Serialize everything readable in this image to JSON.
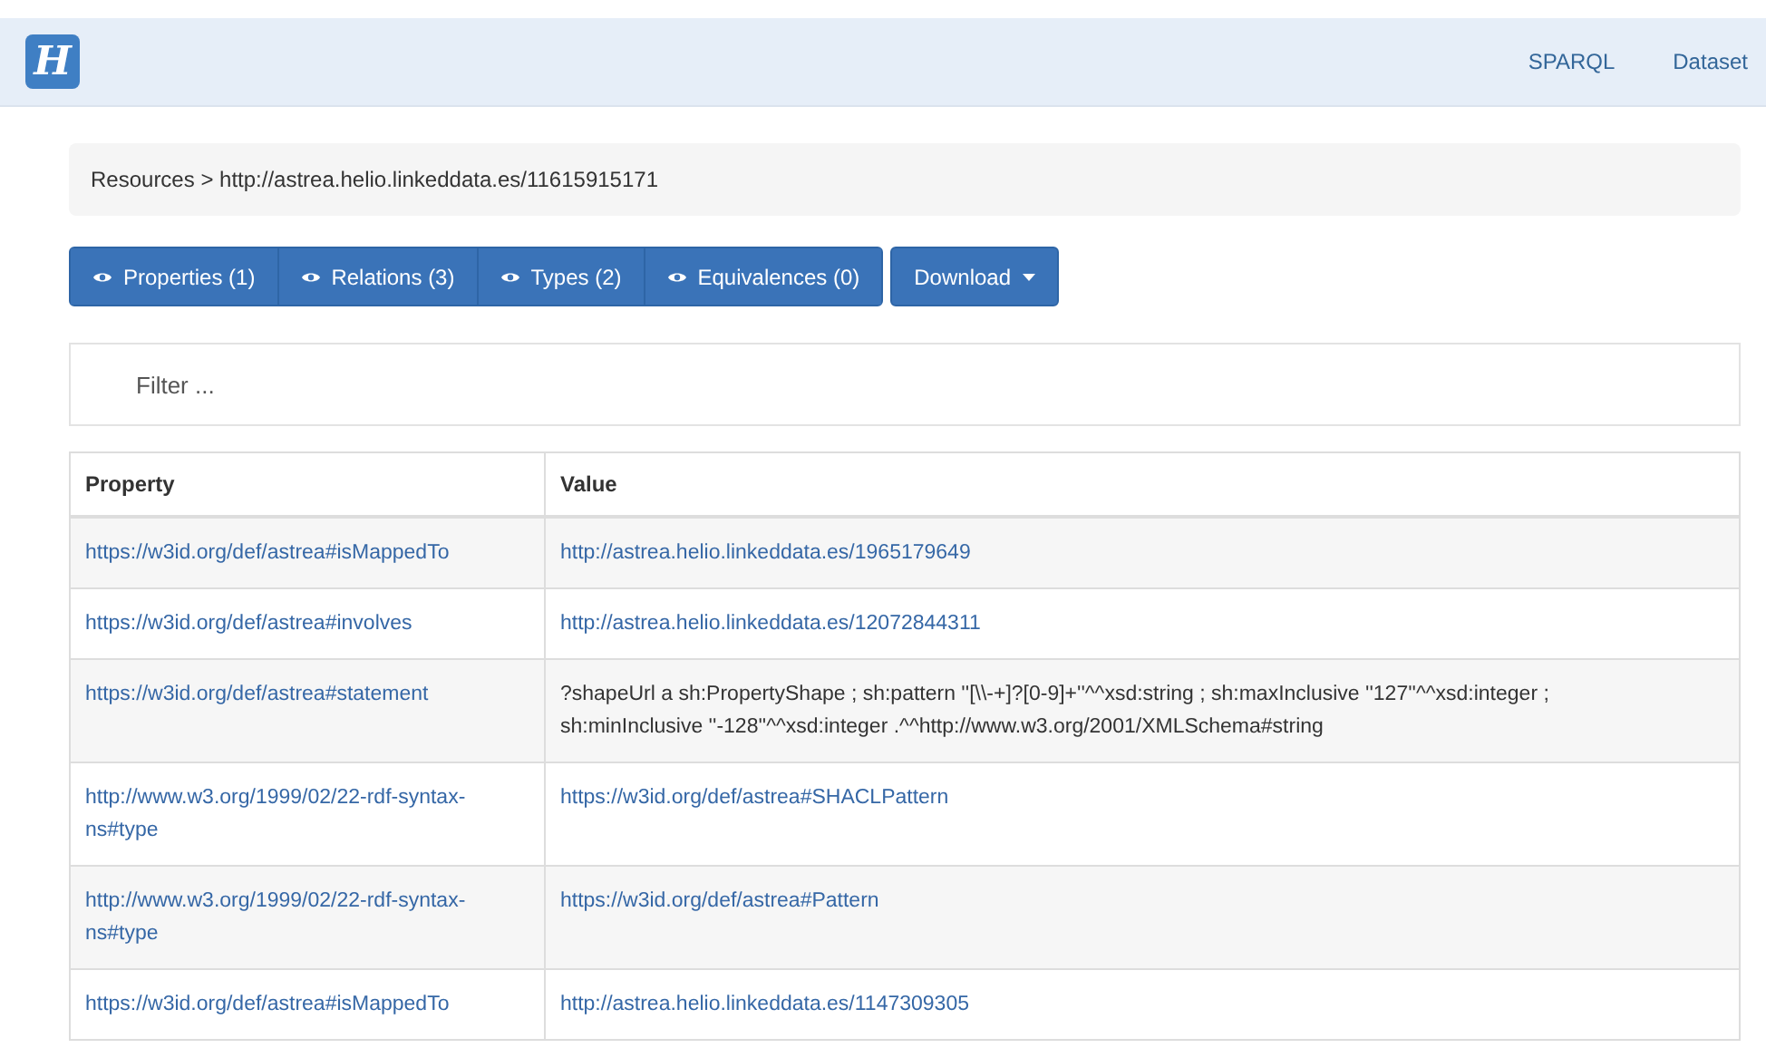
{
  "navbar": {
    "logo": "H",
    "links": [
      "SPARQL",
      "Dataset"
    ]
  },
  "breadcrumb": "Resources > http://astrea.helio.linkeddata.es/11615915171",
  "tabs": [
    {
      "label": "Properties (1)"
    },
    {
      "label": "Relations (3)"
    },
    {
      "label": "Types (2)"
    },
    {
      "label": "Equivalences (0)"
    }
  ],
  "download": {
    "label": "Download"
  },
  "filter": {
    "placeholder": "Filter ..."
  },
  "table": {
    "columns": [
      "Property",
      "Value"
    ],
    "rows": [
      {
        "property": "https://w3id.org/def/astrea#isMappedTo",
        "value": "http://astrea.helio.linkeddata.es/1965179649",
        "kind": "link"
      },
      {
        "property": "https://w3id.org/def/astrea#involves",
        "value": "http://astrea.helio.linkeddata.es/12072844311",
        "kind": "link"
      },
      {
        "property": "https://w3id.org/def/astrea#statement",
        "value": "?shapeUrl a sh:PropertyShape ; sh:pattern ''[\\\\-+]?[0-9]+''^^xsd:string ; sh:maxInclusive ''127''^^xsd:integer ; sh:minInclusive ''-128''^^xsd:integer .^^http://www.w3.org/2001/XMLSchema#string",
        "kind": "text"
      },
      {
        "property": "http://www.w3.org/1999/02/22-rdf-syntax-ns#type",
        "value": "https://w3id.org/def/astrea#SHACLPattern",
        "kind": "link"
      },
      {
        "property": "http://www.w3.org/1999/02/22-rdf-syntax-ns#type",
        "value": "https://w3id.org/def/astrea#Pattern",
        "kind": "link"
      },
      {
        "property": "https://w3id.org/def/astrea#isMappedTo",
        "value": "http://astrea.helio.linkeddata.es/1147309305",
        "kind": "link"
      }
    ]
  }
}
